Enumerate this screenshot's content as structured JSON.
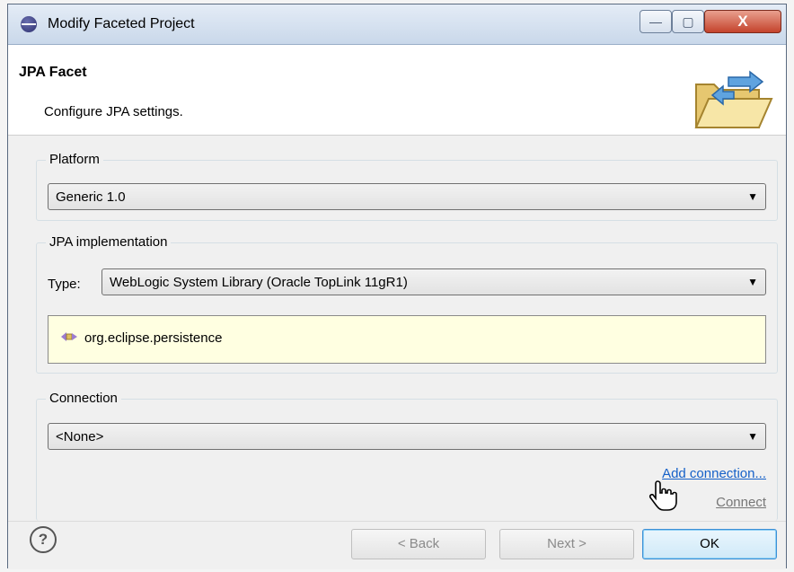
{
  "window": {
    "title": "Modify Faceted Project",
    "minimize_label": "—",
    "maximize_label": "▢",
    "close_label": "X"
  },
  "header": {
    "title": "JPA Facet",
    "description": "Configure JPA settings."
  },
  "platform": {
    "group_label": "Platform",
    "selected": "Generic 1.0"
  },
  "jpa_implementation": {
    "group_label": "JPA implementation",
    "type_label": "Type:",
    "type_selected": "WebLogic System Library (Oracle TopLink 11gR1)",
    "libraries": [
      "org.eclipse.persistence"
    ]
  },
  "connection": {
    "group_label": "Connection",
    "selected": "<None>",
    "add_connection_link": "Add connection...",
    "connect_link": "Connect"
  },
  "footer": {
    "help_label": "?",
    "back_label": "< Back",
    "next_label": "Next >",
    "ok_label": "OK"
  },
  "colors": {
    "link": "#1560c8",
    "library_background": "#ffffe1",
    "ok_border": "#3c8fd6"
  }
}
